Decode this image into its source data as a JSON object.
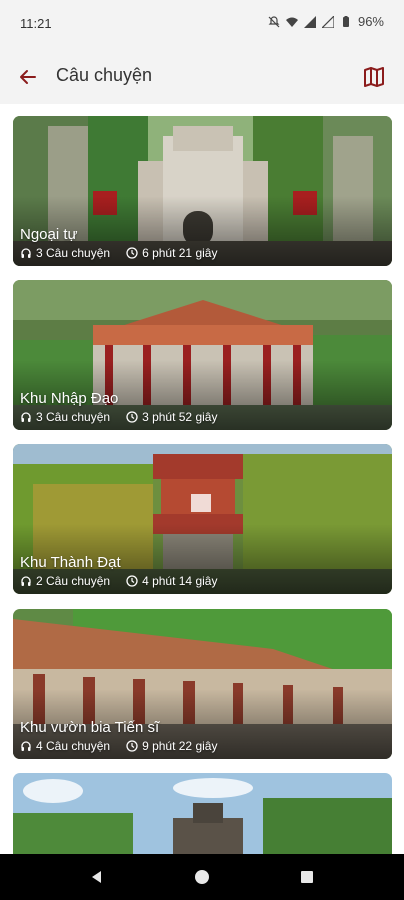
{
  "status_bar": {
    "time": "11:21",
    "battery": "96%"
  },
  "header": {
    "title": "Câu chuyện",
    "accent_color": "#8b1c1c"
  },
  "cards": [
    {
      "title": "Ngoại tự",
      "stories": "3 Câu chuyện",
      "duration": "6 phút 21 giây"
    },
    {
      "title": "Khu Nhập Đạo",
      "stories": "3 Câu chuyện",
      "duration": "3 phút 52 giây"
    },
    {
      "title": "Khu Thành Đạt",
      "stories": "2 Câu chuyện",
      "duration": "4 phút 14 giây"
    },
    {
      "title": "Khu vườn bia Tiến sĩ",
      "stories": "4 Câu chuyện",
      "duration": "9 phút 22 giây"
    },
    {
      "title": "",
      "stories": "",
      "duration": ""
    }
  ],
  "icons": {
    "back": "arrow-left-icon",
    "map": "map-icon",
    "headphones": "headphones-icon",
    "clock": "clock-icon"
  }
}
